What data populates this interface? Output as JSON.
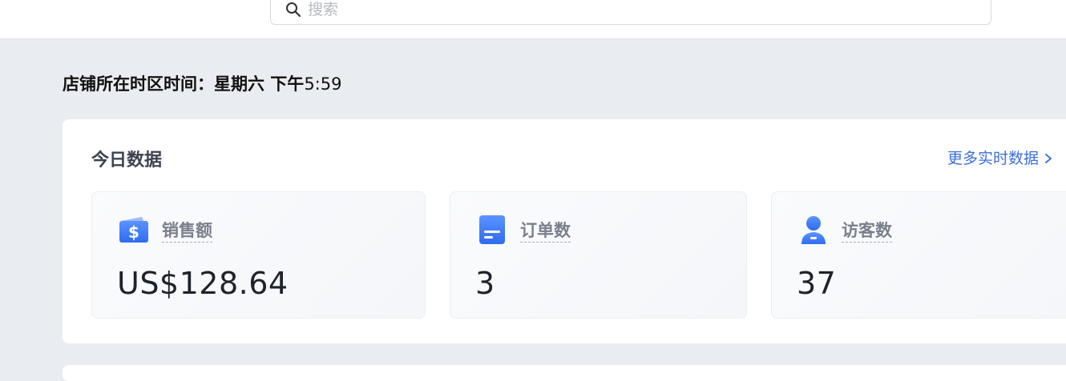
{
  "search": {
    "placeholder": "搜索"
  },
  "store_time": {
    "label": "店铺所在时区时间：星期六 下午",
    "time": "5:59"
  },
  "today": {
    "title": "今日数据",
    "more_link": "更多实时数据",
    "cards": [
      {
        "label": "销售额",
        "value": "US$128.64",
        "icon": "wallet-dollar-icon"
      },
      {
        "label": "订单数",
        "value": "3",
        "icon": "order-document-icon"
      },
      {
        "label": "访客数",
        "value": "37",
        "icon": "visitor-person-icon"
      }
    ]
  },
  "colors": {
    "accent": "#3b6fdc",
    "icon_blue": "#3f7cf5",
    "background": "#e9ecf0"
  }
}
